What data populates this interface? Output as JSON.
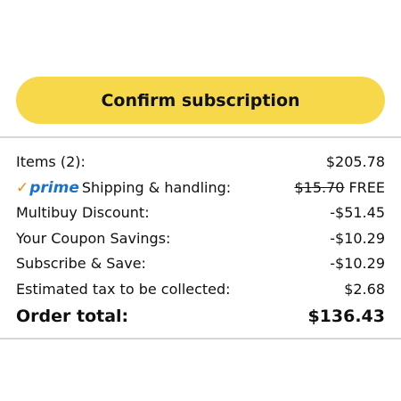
{
  "confirm_button": {
    "label": "Confirm subscription"
  },
  "prime": {
    "check": "✓",
    "word": "prime"
  },
  "summary": {
    "items": {
      "label": "Items (2):",
      "value": "$205.78"
    },
    "shipping": {
      "label": "Shipping & handling:",
      "original_price": "$15.70",
      "value": "FREE"
    },
    "multibuy": {
      "label": "Multibuy Discount:",
      "value": "-$51.45"
    },
    "coupon": {
      "label": "Your Coupon Savings:",
      "value": "-$10.29"
    },
    "subscribe_save": {
      "label": "Subscribe & Save:",
      "value": "-$10.29"
    },
    "tax": {
      "label": "Estimated tax to be collected:",
      "value": "$2.68"
    },
    "total": {
      "label": "Order total:",
      "value": "$136.43"
    }
  },
  "colors": {
    "button_bg": "#f7d84b",
    "prime_check": "#ff8c00",
    "prime_word": "#1a73c8",
    "divider": "#d5d9d9"
  }
}
